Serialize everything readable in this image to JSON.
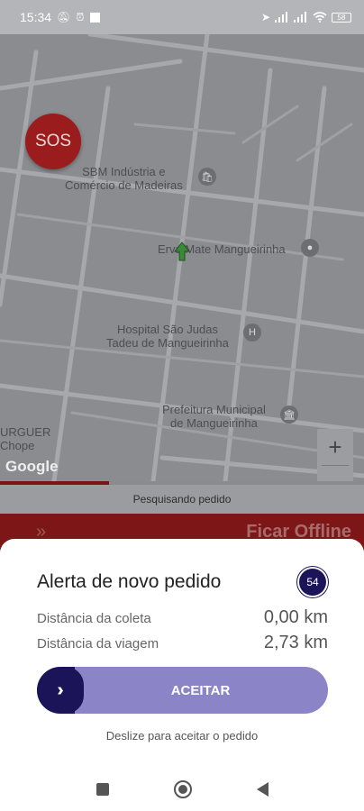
{
  "status_bar": {
    "time": "15:34",
    "battery": "58",
    "left_icons": [
      "notifications-off-icon",
      "alarm-icon",
      "square-icon"
    ],
    "right_icons": [
      "navigation-icon",
      "signal-icon",
      "signal-icon",
      "wifi-icon",
      "battery-icon"
    ]
  },
  "map": {
    "sos_label": "SOS",
    "places": [
      {
        "name": "SBM Indústria e\nComércio de Madeiras",
        "icon": "shop-icon"
      },
      {
        "name": "Erva Mate Mangueirinha",
        "icon": "pin-icon"
      },
      {
        "name": "Hospital São Judas\nTadeu de Mangueirinha",
        "icon": "hospital-icon"
      },
      {
        "name": "Prefeitura Municipal\nde Mangueirinha",
        "icon": "government-icon"
      },
      {
        "name": "URGUER\nChope",
        "icon": ""
      }
    ],
    "google_logo": "Google",
    "zoom_in": "+",
    "zoom_out": "−"
  },
  "search": {
    "progress": 0.3,
    "status_text": "Pesquisando pedido"
  },
  "driver_bar": {
    "status_text": "Ficar Offline"
  },
  "sheet": {
    "title": "Alerta de novo pedido",
    "timer": "54",
    "rows": [
      {
        "label": "Distância da coleta",
        "value": "0,00 km"
      },
      {
        "label": "Distância da viagem",
        "value": "2,73 km"
      }
    ],
    "slider_label": "ACEITAR",
    "hint": "Deslize para aceitar o pedido"
  },
  "colors": {
    "brand_purple": "#1c1459",
    "slider_track": "#8b85c7",
    "sos_red": "#9b1c1c"
  }
}
